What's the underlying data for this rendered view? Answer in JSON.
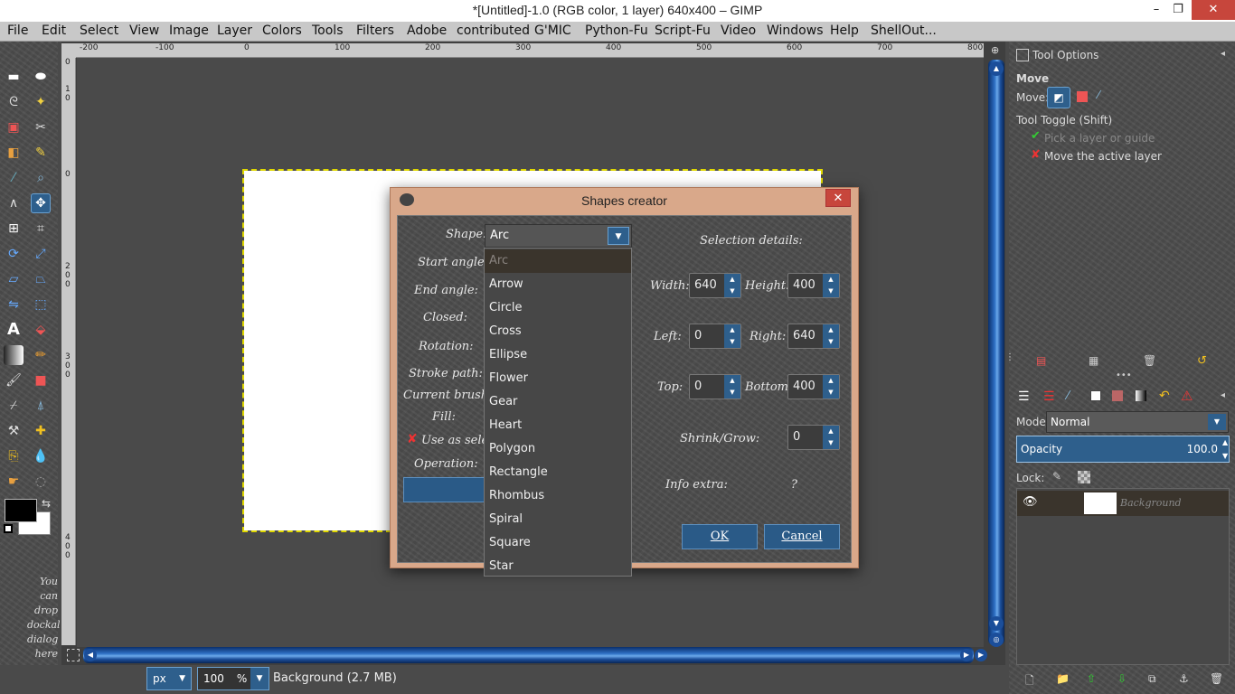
{
  "window": {
    "title": "*[Untitled]-1.0 (RGB color, 1 layer) 640x400 – GIMP",
    "minimize": "–",
    "maximize": "❐",
    "close": "✕"
  },
  "menubar": [
    "File",
    "Edit",
    "Select",
    "View",
    "Image",
    "Layer",
    "Colors",
    "Tools",
    "Filters",
    "Adobe",
    "contributed",
    "G'MIC",
    "Python-Fu",
    "Script-Fu",
    "Video",
    "Windows",
    "Help",
    "ShellOut..."
  ],
  "ruler_top": [
    "-200",
    "-100",
    "0",
    "100",
    "200",
    "300",
    "400",
    "500",
    "600",
    "700",
    "800"
  ],
  "ruler_left": [
    "0",
    "1",
    "0",
    "0",
    "2",
    "0",
    "0",
    "3",
    "0",
    "0",
    "4",
    "0",
    "0"
  ],
  "toolbox": {
    "drop_hint": [
      "You",
      "can",
      "drop",
      "dockal",
      "dialog",
      "here"
    ]
  },
  "statusbar": {
    "unit": "px",
    "zoom": "100",
    "zoom_suffix": "%",
    "text": "Background (2.7 MB)"
  },
  "tool_options": {
    "header": "Tool Options",
    "tool_name": "Move",
    "move_label": "Move:",
    "toggle_label": "Tool Toggle  (Shift)",
    "option_pick": "Pick a layer or guide",
    "option_move": "Move the active layer"
  },
  "layers": {
    "mode_label": "Mode:",
    "mode_value": "Normal",
    "opacity_label": "Opacity",
    "opacity_value": "100.0",
    "lock_label": "Lock:",
    "layer_name": "Background"
  },
  "dialog": {
    "title": "Shapes creator",
    "close": "✕",
    "labels": {
      "shape": "Shape:",
      "start_angle": "Start angle:",
      "end_angle": "End angle:",
      "closed": "Closed:",
      "rotation": "Rotation:",
      "stroke_path": "Stroke path:",
      "current_brush": "Current brush:",
      "fill": "Fill:",
      "use_as_sel": "Use as sele",
      "operation": "Operation:"
    },
    "selection_details": "Selection details:",
    "fields": {
      "width_label": "Width:",
      "width": "640",
      "height_label": "Height:",
      "height": "400",
      "left_label": "Left:",
      "left": "0",
      "right_label": "Right:",
      "right": "640",
      "top_label": "Top:",
      "top": "0",
      "bottom_label": "Bottom:",
      "bottom": "400",
      "shrink_label": "Shrink/Grow:",
      "shrink": "0"
    },
    "info_extra_label": "Info extra:",
    "info_extra_value": "?",
    "ok": "OK",
    "cancel": "Cancel",
    "shape_value": "Arc",
    "shape_options": [
      "Arc",
      "Arrow",
      "Circle",
      "Cross",
      "Ellipse",
      "Flower",
      "Gear",
      "Heart",
      "Polygon",
      "Rectangle",
      "Rhombus",
      "Spiral",
      "Square",
      "Star"
    ]
  },
  "colors": {
    "accent": "#2e5f8c",
    "close_red": "#c7463c",
    "dialog_frame": "#d9a88a"
  }
}
